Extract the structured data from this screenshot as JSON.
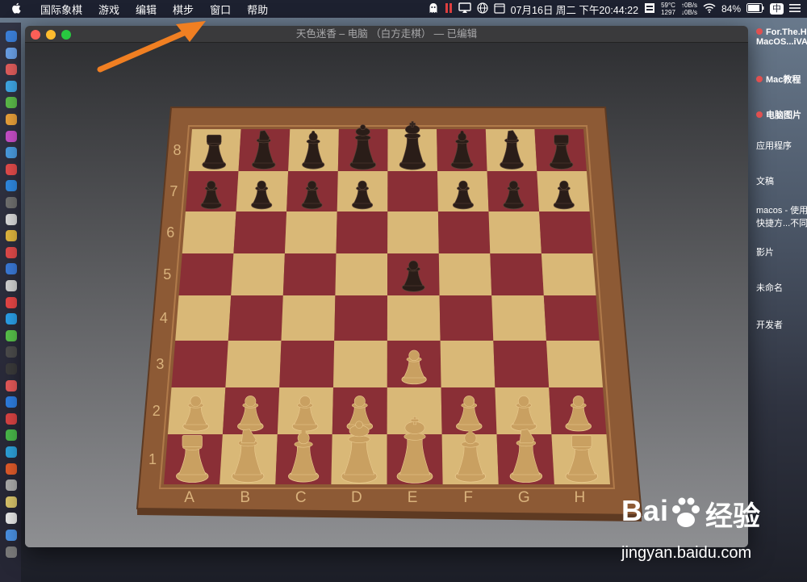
{
  "menubar": {
    "apple": "",
    "items": [
      "国际象棋",
      "游戏",
      "编辑",
      "棋步",
      "窗口",
      "帮助"
    ],
    "status": {
      "temp": "59°C",
      "rpm": "1297",
      "net_up": "↑0B/s",
      "net_down": "↓0B/s",
      "datetime": "07月16日 周二 下午20:44:22",
      "battery": "84%",
      "ime": "中"
    }
  },
  "window": {
    "title": "天色迷香 – 电脑 （白方走棋） — 已编辑"
  },
  "board": {
    "files": [
      "A",
      "B",
      "C",
      "D",
      "E",
      "F",
      "G",
      "H"
    ],
    "ranks": [
      "1",
      "2",
      "3",
      "4",
      "5",
      "6",
      "7",
      "8"
    ],
    "pieces": [
      {
        "sq": "a8",
        "side": "black",
        "type": "rook"
      },
      {
        "sq": "b8",
        "side": "black",
        "type": "knight"
      },
      {
        "sq": "c8",
        "side": "black",
        "type": "bishop"
      },
      {
        "sq": "d8",
        "side": "black",
        "type": "queen"
      },
      {
        "sq": "e8",
        "side": "black",
        "type": "king"
      },
      {
        "sq": "f8",
        "side": "black",
        "type": "bishop"
      },
      {
        "sq": "g8",
        "side": "black",
        "type": "knight"
      },
      {
        "sq": "h8",
        "side": "black",
        "type": "rook"
      },
      {
        "sq": "a7",
        "side": "black",
        "type": "pawn"
      },
      {
        "sq": "b7",
        "side": "black",
        "type": "pawn"
      },
      {
        "sq": "c7",
        "side": "black",
        "type": "pawn"
      },
      {
        "sq": "d7",
        "side": "black",
        "type": "pawn"
      },
      {
        "sq": "f7",
        "side": "black",
        "type": "pawn"
      },
      {
        "sq": "g7",
        "side": "black",
        "type": "pawn"
      },
      {
        "sq": "h7",
        "side": "black",
        "type": "pawn"
      },
      {
        "sq": "e5",
        "side": "black",
        "type": "pawn"
      },
      {
        "sq": "e3",
        "side": "white",
        "type": "pawn"
      },
      {
        "sq": "a2",
        "side": "white",
        "type": "pawn"
      },
      {
        "sq": "b2",
        "side": "white",
        "type": "pawn"
      },
      {
        "sq": "c2",
        "side": "white",
        "type": "pawn"
      },
      {
        "sq": "d2",
        "side": "white",
        "type": "pawn"
      },
      {
        "sq": "f2",
        "side": "white",
        "type": "pawn"
      },
      {
        "sq": "g2",
        "side": "white",
        "type": "pawn"
      },
      {
        "sq": "h2",
        "side": "white",
        "type": "pawn"
      },
      {
        "sq": "a1",
        "side": "white",
        "type": "rook"
      },
      {
        "sq": "b1",
        "side": "white",
        "type": "knight"
      },
      {
        "sq": "c1",
        "side": "white",
        "type": "bishop"
      },
      {
        "sq": "d1",
        "side": "white",
        "type": "queen"
      },
      {
        "sq": "e1",
        "side": "white",
        "type": "king"
      },
      {
        "sq": "f1",
        "side": "white",
        "type": "bishop"
      },
      {
        "sq": "g1",
        "side": "white",
        "type": "knight"
      },
      {
        "sq": "h1",
        "side": "white",
        "type": "rook"
      }
    ],
    "colors": {
      "light": "#d9b877",
      "dark": "#8a2f36",
      "frame": "#8d5a35",
      "black_piece": "#2a1d18",
      "white_piece": "#c9a061"
    }
  },
  "desktop": {
    "items": [
      {
        "label": "For.The.H",
        "label2": "MacOS...iVA",
        "dot": true
      },
      {
        "label": "Mac教程",
        "dot": true
      },
      {
        "label": "电脑图片",
        "dot": true
      },
      {
        "label": "应用程序",
        "dot": false
      },
      {
        "label": "文稿",
        "dot": false
      },
      {
        "label": "macos - 使用",
        "label2": "快捷方...不同",
        "dot": false
      },
      {
        "label": "影片",
        "dot": false
      },
      {
        "label": "未命名",
        "dot": false
      },
      {
        "label": "开发者",
        "dot": false
      }
    ]
  },
  "watermark": {
    "brand": "Bai",
    "brand2": "经验",
    "url": "jingyan.baidu.com"
  }
}
